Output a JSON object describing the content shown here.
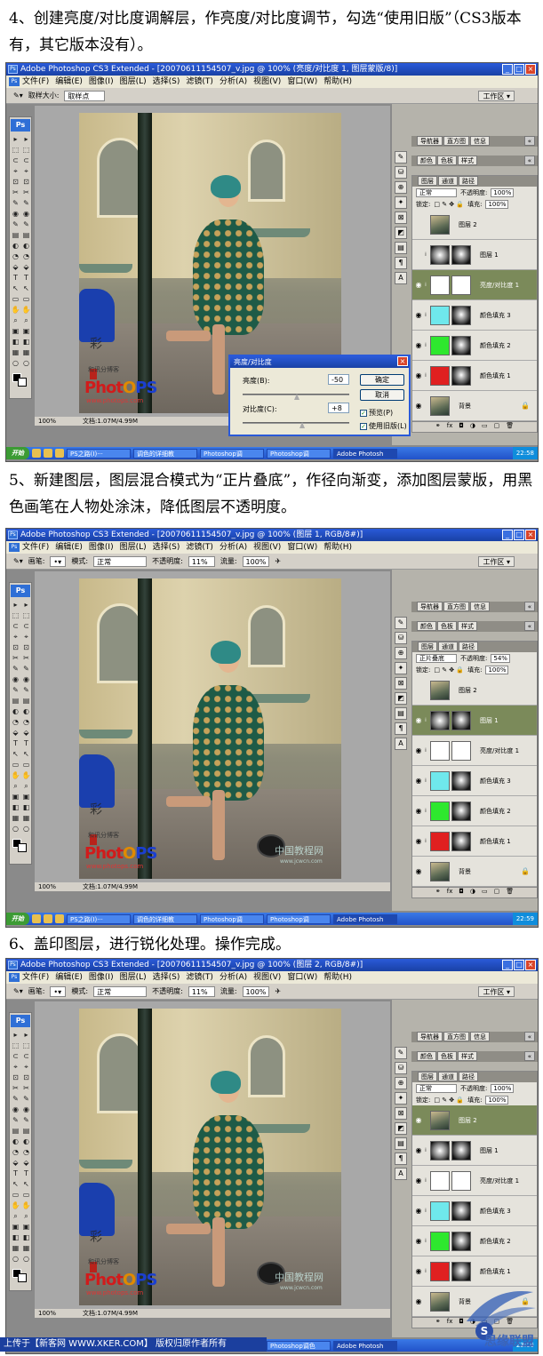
{
  "steps": [
    {
      "text": "4、创建亮度/对比度调解层，作亮度/对比度调节，勾选“使用旧版”（CS3版本有，其它版本没有）。",
      "screenshot": {
        "window_title": "Adobe Photoshop CS3 Extended - [20070611154507_v.jpg @ 100% (亮度/对比度 1, 图层蒙版/8)]",
        "menu": [
          "文件(F)",
          "编辑(E)",
          "图像(I)",
          "图层(L)",
          "选择(S)",
          "滤镜(T)",
          "分析(A)",
          "视图(V)",
          "窗口(W)",
          "帮助(H)"
        ],
        "options": {
          "label": "取样大小:",
          "value": "取样点"
        },
        "workspace": "工作区 ▾",
        "panel_tabs_top": [
          "导航器",
          "直方图",
          "信息"
        ],
        "panel_tabs_mid": [
          "颜色",
          "色板",
          "样式"
        ],
        "panel_tabs_layers": [
          "图层",
          "通道",
          "路径"
        ],
        "blend_mode": "正常",
        "opacity_label": "不透明度:",
        "opacity": "100%",
        "lock_label": "锁定:",
        "fill_label": "填充:",
        "fill": "100%",
        "layers": [
          {
            "name": "图层 2",
            "thumb": "photo",
            "eye": false,
            "active": false
          },
          {
            "name": "图层 1",
            "thumb": "mask",
            "eye": false,
            "active": false
          },
          {
            "name": "亮度/对比度 1",
            "thumb": "adj",
            "eye": true,
            "active": true
          },
          {
            "name": "颜色填充 3",
            "thumb": "cyan",
            "eye": true,
            "active": false
          },
          {
            "name": "颜色填充 2",
            "thumb": "green",
            "eye": true,
            "active": false
          },
          {
            "name": "颜色填充 1",
            "thumb": "red",
            "eye": true,
            "active": false
          },
          {
            "name": "背景",
            "thumb": "photo",
            "eye": true,
            "active": false
          }
        ],
        "status": {
          "zoom": "100%",
          "doc": "文档:1.07M/4.99M"
        },
        "dialog": {
          "title": "亮度/对比度",
          "brightness_label": "亮度(B):",
          "brightness_value": "-50",
          "contrast_label": "对比度(C):",
          "contrast_value": "+8",
          "ok": "确定",
          "cancel": "取消",
          "preview": "预览(P)",
          "legacy": "使用旧版(L)"
        },
        "taskbar": {
          "start": "开始",
          "tasks": [
            "PS之路(I)···",
            "调色的详细教",
            "Photoshop调",
            "Photoshop调",
            "Adobe Photosh"
          ],
          "clock": "22:58"
        }
      }
    },
    {
      "text": "5、新建图层，图层混合模式为“正片叠底”，作径向渐变，添加图层蒙版，用黑色画笔在人物处涂沫，降低图层不透明度。",
      "screenshot": {
        "window_title": "Adobe Photoshop CS3 Extended - [20070611154507_v.jpg @ 100% (图层 1, RGB/8#)]",
        "menu": [
          "文件(F)",
          "编辑(E)",
          "图像(I)",
          "图层(L)",
          "选择(S)",
          "滤镜(T)",
          "分析(A)",
          "视图(V)",
          "窗口(W)",
          "帮助(H)"
        ],
        "options": {
          "brush_label": "画笔:",
          "mode_label": "模式:",
          "mode": "正常",
          "opacity_label": "不透明度:",
          "opacity": "11%",
          "flow_label": "流量:",
          "flow": "100%"
        },
        "workspace": "工作区 ▾",
        "panel_tabs_top": [
          "导航器",
          "直方图",
          "信息"
        ],
        "panel_tabs_mid": [
          "颜色",
          "色板",
          "样式"
        ],
        "panel_tabs_layers": [
          "图层",
          "通道",
          "路径"
        ],
        "blend_mode": "正片叠底",
        "opacity_label": "不透明度:",
        "opacity": "54%",
        "lock_label": "锁定:",
        "fill_label": "填充:",
        "fill": "100%",
        "layers": [
          {
            "name": "图层 2",
            "thumb": "photo",
            "eye": false,
            "active": false
          },
          {
            "name": "图层 1",
            "thumb": "mask",
            "eye": true,
            "active": true
          },
          {
            "name": "亮度/对比度 1",
            "thumb": "adj",
            "eye": true,
            "active": false
          },
          {
            "name": "颜色填充 3",
            "thumb": "cyan",
            "eye": true,
            "active": false
          },
          {
            "name": "颜色填充 2",
            "thumb": "green",
            "eye": true,
            "active": false
          },
          {
            "name": "颜色填充 1",
            "thumb": "red",
            "eye": true,
            "active": false
          },
          {
            "name": "背景",
            "thumb": "photo",
            "eye": true,
            "active": false
          }
        ],
        "status": {
          "zoom": "100%",
          "doc": "文档:1.07M/4.99M"
        },
        "watermark": "中国教程网",
        "watermark_url": "www.jcwcn.com",
        "taskbar": {
          "start": "开始",
          "tasks": [
            "PS之路(I)···",
            "调色的详细教",
            "Photoshop调",
            "Photoshop调",
            "Adobe Photosh"
          ],
          "clock": "22:59"
        }
      }
    },
    {
      "text": "6、盖印图层，进行锐化处理。操作完成。",
      "screenshot": {
        "window_title": "Adobe Photoshop CS3 Extended - [20070611154507_v.jpg @ 100% (图层 2, RGB/8#)]",
        "menu": [
          "文件(F)",
          "编辑(E)",
          "图像(I)",
          "图层(L)",
          "选择(S)",
          "滤镜(T)",
          "分析(A)",
          "视图(V)",
          "窗口(W)",
          "帮助(H)"
        ],
        "options": {
          "brush_label": "画笔:",
          "mode_label": "模式:",
          "mode": "正常",
          "opacity_label": "不透明度:",
          "opacity": "11%",
          "flow_label": "流量:",
          "flow": "100%"
        },
        "workspace": "工作区 ▾",
        "panel_tabs_top": [
          "导航器",
          "直方图",
          "信息"
        ],
        "panel_tabs_mid": [
          "颜色",
          "色板",
          "样式"
        ],
        "panel_tabs_layers": [
          "图层",
          "通道",
          "路径"
        ],
        "blend_mode": "正常",
        "opacity_label": "不透明度:",
        "opacity": "100%",
        "lock_label": "锁定:",
        "fill_label": "填充:",
        "fill": "100%",
        "layers": [
          {
            "name": "图层 2",
            "thumb": "photo",
            "eye": true,
            "active": true
          },
          {
            "name": "图层 1",
            "thumb": "mask",
            "eye": true,
            "active": false
          },
          {
            "name": "亮度/对比度 1",
            "thumb": "adj",
            "eye": true,
            "active": false
          },
          {
            "name": "颜色填充 3",
            "thumb": "cyan",
            "eye": true,
            "active": false
          },
          {
            "name": "颜色填充 2",
            "thumb": "green",
            "eye": true,
            "active": false
          },
          {
            "name": "颜色填充 1",
            "thumb": "red",
            "eye": true,
            "active": false
          },
          {
            "name": "背景",
            "thumb": "photo",
            "eye": true,
            "active": false
          }
        ],
        "status": {
          "zoom": "100%",
          "doc": "文档:1.07M/4.99M"
        },
        "watermark": "中国教程网",
        "watermark_url": "www.jcwcn.com",
        "taskbar": {
          "start": "开始",
          "tasks": [
            "PS之路(I)···",
            "调色的详细教",
            "Photoshop调色",
            "Photoshop调色",
            "Adobe Photosh"
          ],
          "clock": "23:06"
        }
      }
    }
  ],
  "photo_logo": {
    "small": "和讯分博客",
    "brand_a": "Phot",
    "brand_b": "O",
    "brand_c": "PS",
    "url": "www.photops.com"
  },
  "footer": "上传于【新客网 WWW.XKER.COM】 版权归原作者所有",
  "corner_logo": {
    "letters": "S",
    "text": "思缘联盟"
  },
  "colors": {
    "title_blue": "#1941a5",
    "active_layer": "#7b8a5a",
    "fill_cyan": "#6fe8ec",
    "fill_green": "#2ee82e",
    "fill_red": "#e02020"
  }
}
